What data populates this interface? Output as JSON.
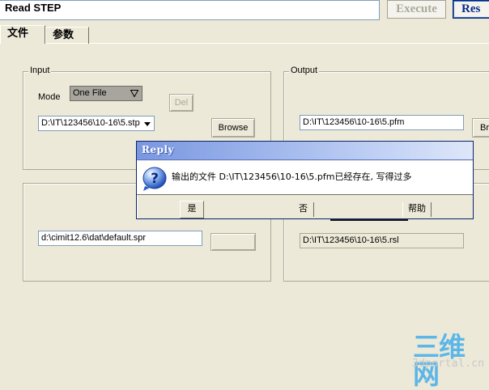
{
  "header": {
    "title": "Read STEP",
    "execute_label": "Execute",
    "reset_label": "Res"
  },
  "tabs": [
    {
      "label": "文件"
    },
    {
      "label": "参数"
    }
  ],
  "input_group": {
    "label": "Input",
    "mode_label": "Mode",
    "mode_value": "One File",
    "del_label": "Del",
    "file_path": "D:\\IT\\123456\\10-16\\5.stp",
    "browse_label": "Browse"
  },
  "output_group": {
    "label": "Output",
    "file_path": "D:\\IT\\123456\\10-16\\5.pfm",
    "browse_label": "Br"
  },
  "second_group": {
    "path": "d:\\cimit12.6\\dat\\default.spr"
  },
  "right_lower_group": {
    "path": "D:\\IT\\123456\\10-16\\5.rsl"
  },
  "dialog": {
    "title": "Reply",
    "message": "输出的文件 D:\\IT\\123456\\10-16\\5.pfm已经存在, 写得过多",
    "yes_label": "是",
    "no_label": "否",
    "help_label": "帮助"
  },
  "watermark": {
    "logo": "三维网",
    "url": "3dportal.cn"
  },
  "icons": {
    "dropdown": "triangle-down-icon",
    "dialog": "question-icon"
  }
}
